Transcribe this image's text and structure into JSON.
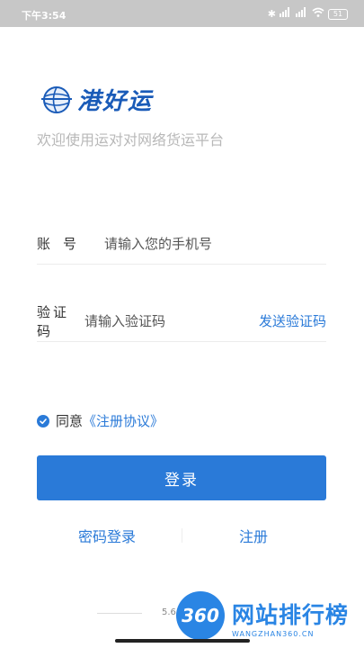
{
  "status_bar": {
    "time": "下午3:54",
    "battery": "51",
    "icons": [
      "bluetooth-icon",
      "signal-hd-icon",
      "signal-icon",
      "wifi-icon",
      "battery-icon"
    ]
  },
  "brand": {
    "logo_name": "港好运",
    "tagline": "欢迎使用运对对网络货运平台",
    "colors": {
      "primary": "#2a7ad8",
      "logo": "#1a5bb8"
    }
  },
  "form": {
    "account_label": "账号",
    "account_placeholder": "请输入您的手机号",
    "code_label": "验证码",
    "code_placeholder": "请输入验证码",
    "send_code_label": "发送验证码"
  },
  "agreement": {
    "prefix": "同意",
    "link": "《注册协议》"
  },
  "actions": {
    "login_label": "登录",
    "password_login_label": "密码登录",
    "register_label": "注册"
  },
  "footer": {
    "version": "5.6("
  },
  "watermark": {
    "circle_text": "360",
    "title": "网站排行榜",
    "subtitle": "WANGZHAN360.CN"
  }
}
